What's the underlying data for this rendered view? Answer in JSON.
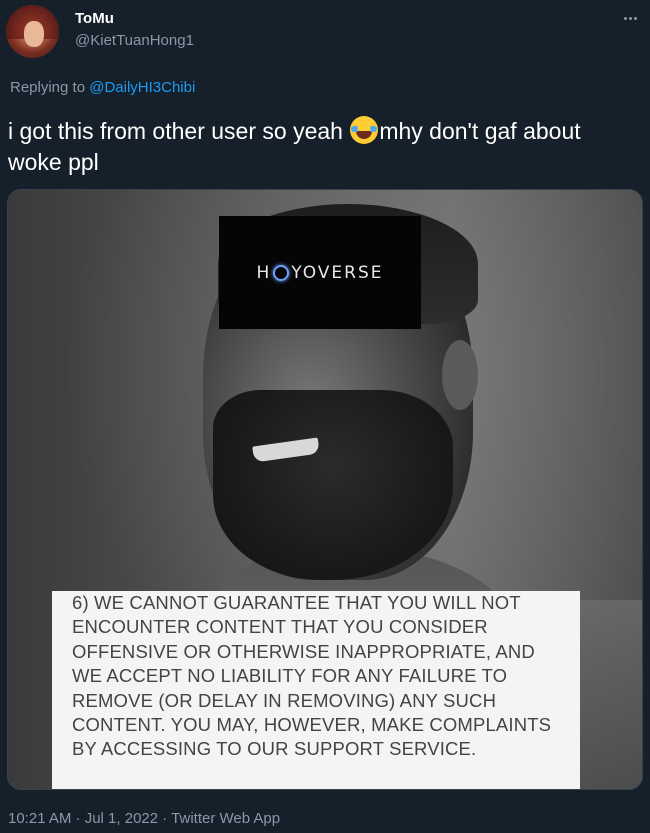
{
  "tweet": {
    "display_name": "ToMu",
    "handle": "@KietTuanHong1",
    "reply_prefix": "Replying to",
    "reply_mention": "@DailyHI3Chibi",
    "text_part1": "i got this from other user so yeah ",
    "emoji": "face-with-tears-of-joy-icon",
    "text_part2": "mhy don't gaf about woke ppl",
    "timestamp": "10:21 AM · Jul 1, 2022 · Twitter Web App"
  },
  "media": {
    "logo_text_before": "H",
    "logo_text_after": "YOVERSE",
    "notice_text": "6)  WE CANNOT GUARANTEE THAT YOU WILL NOT ENCOUNTER CONTENT THAT YOU CONSIDER OFFENSIVE OR OTHERWISE INAPPROPRIATE, AND WE ACCEPT NO LIABILITY FOR ANY FAILURE TO REMOVE (OR DELAY IN REMOVING) ANY SUCH CONTENT. YOU MAY, HOWEVER, MAKE COMPLAINTS BY ACCESSING TO OUR SUPPORT SERVICE."
  },
  "colors": {
    "background": "#15202b",
    "link": "#1d9bf0",
    "secondary_text": "#8b98a5"
  }
}
